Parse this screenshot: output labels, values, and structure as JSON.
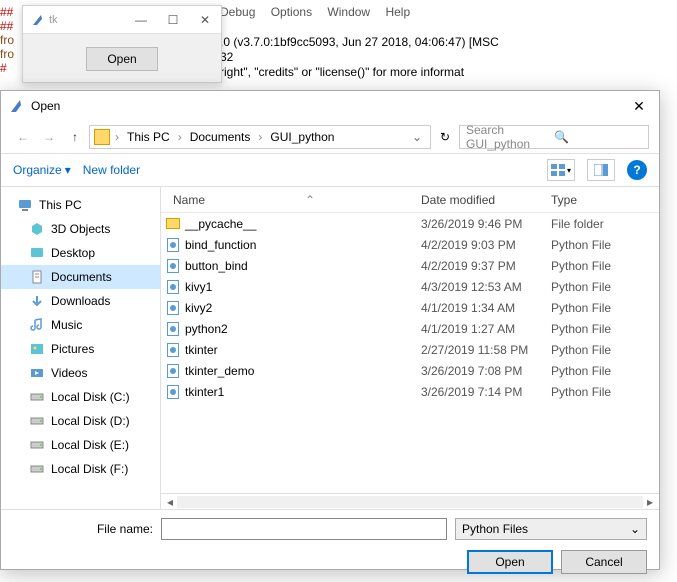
{
  "shell": {
    "menu": [
      "Debug",
      "Options",
      "Window",
      "Help"
    ],
    "line1": ".0 (v3.7.0:1bf9cc5093, Jun 27 2018, 04:06:47) [MSC",
    "line2": "32",
    "line3": "right\", \"credits\" or \"license()\" for more informat",
    "left": [
      "##",
      "##",
      "fro",
      "fro",
      "#"
    ]
  },
  "tk": {
    "title": "tk",
    "button": "Open"
  },
  "dialog": {
    "title": "Open",
    "breadcrumb": [
      "This PC",
      "Documents",
      "GUI_python"
    ],
    "search_placeholder": "Search GUI_python",
    "organize": "Organize",
    "new_folder": "New folder",
    "columns": {
      "name": "Name",
      "date": "Date modified",
      "type": "Type"
    },
    "sidebar": [
      {
        "label": "This PC",
        "icon": "pc"
      },
      {
        "label": "3D Objects",
        "icon": "3d",
        "child": true
      },
      {
        "label": "Desktop",
        "icon": "desktop",
        "child": true
      },
      {
        "label": "Documents",
        "icon": "docs",
        "child": true,
        "selected": true
      },
      {
        "label": "Downloads",
        "icon": "down",
        "child": true
      },
      {
        "label": "Music",
        "icon": "music",
        "child": true
      },
      {
        "label": "Pictures",
        "icon": "pics",
        "child": true
      },
      {
        "label": "Videos",
        "icon": "vids",
        "child": true
      },
      {
        "label": "Local Disk (C:)",
        "icon": "disk",
        "child": true
      },
      {
        "label": "Local Disk (D:)",
        "icon": "disk",
        "child": true
      },
      {
        "label": "Local Disk (E:)",
        "icon": "disk",
        "child": true
      },
      {
        "label": "Local Disk (F:)",
        "icon": "disk",
        "child": true
      }
    ],
    "files": [
      {
        "name": "__pycache__",
        "date": "3/26/2019 9:46 PM",
        "type": "File folder",
        "icon": "folder"
      },
      {
        "name": "bind_function",
        "date": "4/2/2019 9:03 PM",
        "type": "Python File",
        "icon": "py"
      },
      {
        "name": "button_bind",
        "date": "4/2/2019 9:37 PM",
        "type": "Python File",
        "icon": "py"
      },
      {
        "name": "kivy1",
        "date": "4/3/2019 12:53 AM",
        "type": "Python File",
        "icon": "py"
      },
      {
        "name": "kivy2",
        "date": "4/1/2019 1:34 AM",
        "type": "Python File",
        "icon": "py"
      },
      {
        "name": "python2",
        "date": "4/1/2019 1:27 AM",
        "type": "Python File",
        "icon": "py"
      },
      {
        "name": "tkinter",
        "date": "2/27/2019 11:58 PM",
        "type": "Python File",
        "icon": "py"
      },
      {
        "name": "tkinter_demo",
        "date": "3/26/2019 7:08 PM",
        "type": "Python File",
        "icon": "py"
      },
      {
        "name": "tkinter1",
        "date": "3/26/2019 7:14 PM",
        "type": "Python File",
        "icon": "py"
      }
    ],
    "filename_label": "File name:",
    "filename_value": "",
    "filter": "Python Files",
    "open_btn": "Open",
    "cancel_btn": "Cancel"
  }
}
